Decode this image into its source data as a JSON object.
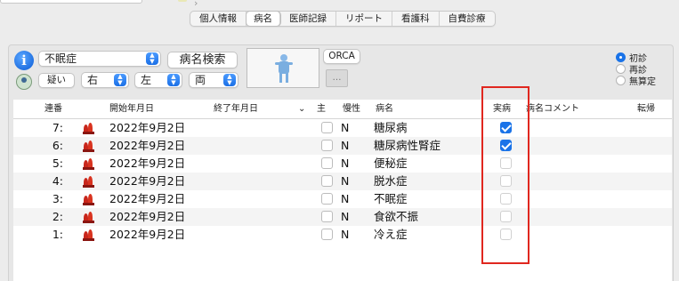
{
  "tabs": [
    {
      "label": "個人情報",
      "active": false
    },
    {
      "label": "病名",
      "active": true
    },
    {
      "label": "医師記録",
      "active": false
    },
    {
      "label": "リポート",
      "active": false
    },
    {
      "label": "看護科",
      "active": false
    },
    {
      "label": "自費診療",
      "active": false
    }
  ],
  "form": {
    "disease_value": "不眠症",
    "search_button": "病名検索",
    "suspect_button": "疑い",
    "side_value": "右",
    "position_value": "左",
    "both_value": "両",
    "orca_button": "ORCA",
    "orca_sub_label": "…"
  },
  "radios": [
    {
      "label": "初診",
      "selected": true
    },
    {
      "label": "再診",
      "selected": false
    },
    {
      "label": "無算定",
      "selected": false
    }
  ],
  "table": {
    "headers": {
      "seq": "連番",
      "start": "開始年月日",
      "end": "終了年月日",
      "main": "主",
      "chronic": "慢性",
      "name": "病名",
      "actual": "実病",
      "comment": "病名コメント",
      "outcome": "転帰"
    },
    "rows": [
      {
        "seq": "7:",
        "start": "2022年9月2日",
        "chronic": "N",
        "name": "糖尿病",
        "actual": true
      },
      {
        "seq": "6:",
        "start": "2022年9月2日",
        "chronic": "N",
        "name": "糖尿病性腎症",
        "actual": true
      },
      {
        "seq": "5:",
        "start": "2022年9月2日",
        "chronic": "N",
        "name": "便秘症",
        "actual": false
      },
      {
        "seq": "4:",
        "start": "2022年9月2日",
        "chronic": "N",
        "name": "脱水症",
        "actual": false
      },
      {
        "seq": "3:",
        "start": "2022年9月2日",
        "chronic": "N",
        "name": "不眠症",
        "actual": false
      },
      {
        "seq": "2:",
        "start": "2022年9月2日",
        "chronic": "N",
        "name": "食欲不振",
        "actual": false
      },
      {
        "seq": "1:",
        "start": "2022年9月2日",
        "chronic": "N",
        "name": "冷え症",
        "actual": false
      }
    ]
  },
  "colors": {
    "accent": "#1a73e8",
    "highlight": "#e0271f",
    "icon_fire": "#c8261b"
  }
}
